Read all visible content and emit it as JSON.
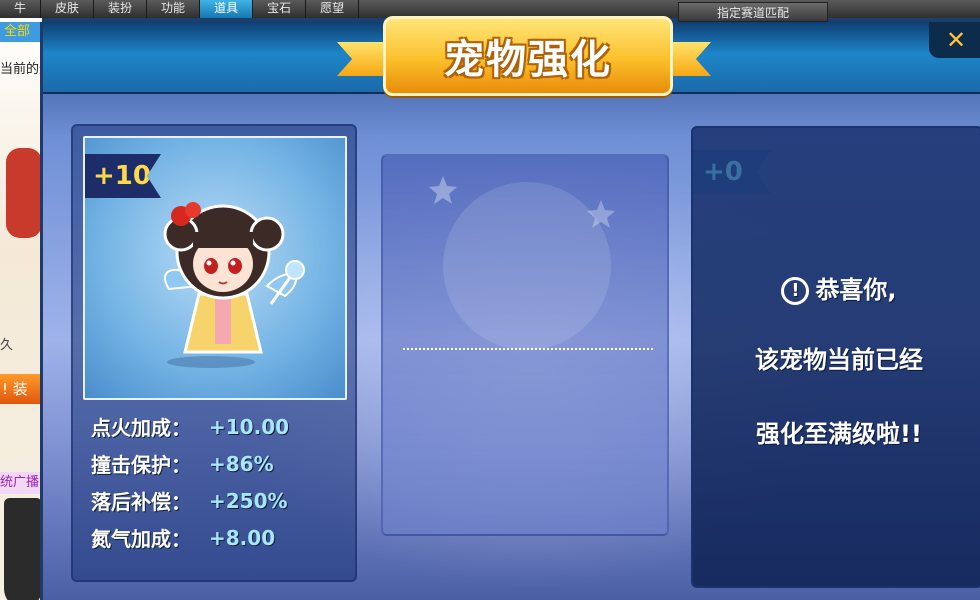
{
  "background": {
    "tabs": [
      "牛",
      "皮肤",
      "装扮",
      "功能",
      "道具",
      "宝石",
      "愿望"
    ],
    "active_tab_index": 4,
    "right_tab": "指定赛道匹配",
    "sidebar": {
      "all_label": "全部",
      "current_label": "当前的道",
      "permanent_label": "久",
      "equip_label": "! 装",
      "ad_label": "统广播"
    }
  },
  "dialog": {
    "title": "宠物强化",
    "close_label": "✕"
  },
  "pet": {
    "level_badge": "+10",
    "stats": [
      {
        "label": "点火加成：",
        "value": "+10.00"
      },
      {
        "label": "撞击保护：",
        "value": "+86%"
      },
      {
        "label": "落后补偿：",
        "value": "+250%"
      },
      {
        "label": "氮气加成：",
        "value": "+8.00"
      }
    ]
  },
  "result": {
    "level_badge": "+0",
    "info_icon": "!",
    "line1": "恭喜你,",
    "line2": "该宠物当前已经",
    "line3": "强化至满级啦!!"
  },
  "colors": {
    "title_gold": "#fbc02a",
    "stat_value": "#a8e6ff",
    "close_x": "#ffc53a"
  }
}
